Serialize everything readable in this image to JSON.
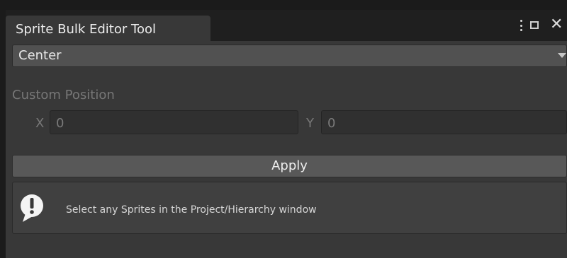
{
  "window": {
    "tab_title": "Sprite Bulk Editor Tool",
    "actions": {
      "menu_icon": "kebab-icon",
      "maximize_icon": "maximize-icon",
      "close_glyph": "✕"
    }
  },
  "pivot": {
    "selected": "Center"
  },
  "custom_position": {
    "label": "Custom Position",
    "x_label": "X",
    "x_value": "0",
    "y_label": "Y",
    "y_value": "0"
  },
  "apply_button": {
    "label": "Apply"
  },
  "help": {
    "icon": "exclamation-icon",
    "message": "Select any Sprites in the Project/Hierarchy window"
  },
  "colors": {
    "panel_bg": "#383838",
    "tab_bar_bg": "#1f1f1f",
    "dropdown_bg": "#515151",
    "button_bg": "#585858",
    "disabled_text": "#777777"
  }
}
